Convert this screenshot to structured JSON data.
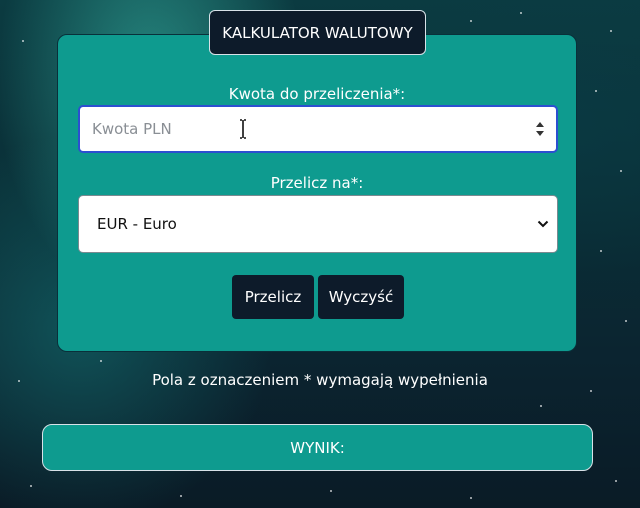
{
  "header": {
    "title": "KALKULATOR WALUTOWY"
  },
  "form": {
    "amount_label": "Kwota do przeliczenia*:",
    "amount_placeholder": "Kwota PLN",
    "amount_value": "",
    "currency_label": "Przelicz na*:",
    "currency_selected": "EUR - Euro",
    "convert_button": "Przelicz",
    "clear_button": "Wyczyść"
  },
  "note": "Pola z oznaczeniem * wymagają wypełnienia",
  "result": {
    "label": "WYNIK:"
  },
  "colors": {
    "card": "#0e9b8f",
    "button": "#0d1b2a",
    "focus_border": "#2c4fd1"
  },
  "icons": [
    "text-cursor-icon",
    "number-spinner-icon",
    "chevron-down-icon"
  ]
}
